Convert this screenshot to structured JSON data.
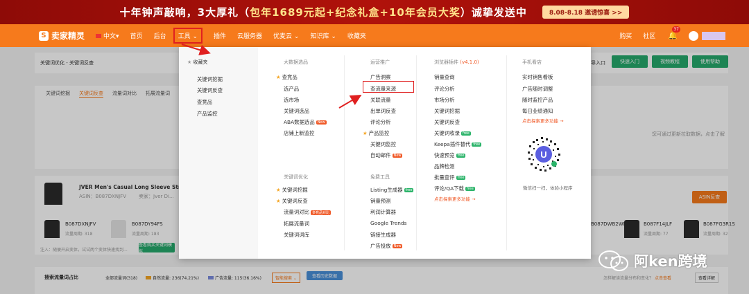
{
  "banner": {
    "text_prefix": "十年钟声敲响，3大厚礼（",
    "text_highlight": "包年1689元起+纪念礼盒+10年会员大奖",
    "text_suffix": "）诚挚发送中",
    "cta": "8.08-8.18 邀请惊喜 >>"
  },
  "topnav": {
    "logo": "卖家精灵",
    "items": [
      "中文",
      "首页",
      "后台",
      "工具",
      "插件",
      "云服务器",
      "优麦云",
      "知识库",
      "收藏夹"
    ],
    "tools_label": "工具",
    "right_items": [
      "购买",
      "社区"
    ],
    "bell_count": "37"
  },
  "background": {
    "breadcrumb": "关键词优化 - 关键词反查",
    "tabs": [
      "关键词挖掘",
      "关键词反查",
      "流量词对比",
      "拓展流量词"
    ],
    "quick_entry": "快速入门",
    "help_tutorial": "视频教程",
    "usage_help": "使用帮助",
    "import_label": "导入口",
    "notice": "您可通过更新拉取数据，点击了解",
    "product_title": "JVER Men's Casual Long Sleeve Stretch Dr...",
    "asin_line": "ASIN：B087DXNJFV",
    "seller": "卖家：Jver Di...",
    "asin_btn": "ASIN反查",
    "variants": [
      "B087DXNJFV",
      "B087DY94FS",
      "B087DWB2WP",
      "B087F14JLF",
      "B087FG3R1S"
    ],
    "variant_sub": [
      "流量周期: 318",
      "流量周期: 183",
      "",
      "流量周期: 77",
      "流量周期: 32"
    ],
    "hint": "注入：随便开启变体，试试两个变体快速找到...",
    "batch_btn": "查看购买关键词模拟",
    "share_title": "搜索流量词占比",
    "share_total": "全部流量词(318)",
    "share_natural": "自然流量: 236(74.21%)",
    "share_ad": "广告流量: 115(36.16%)",
    "share_select": "智能搜索",
    "share_export": "查看历史数据",
    "share_right": "怎样解读流量分布和变化？",
    "share_link": "点击查看",
    "share_right2": "查看详解"
  },
  "dropdown": {
    "fav": {
      "title": "收藏夹",
      "items": [
        "关键词挖掘",
        "关键词反查",
        "查竞品",
        "产品监控"
      ]
    },
    "data_select": {
      "title": "大数据选品",
      "items": [
        {
          "label": "查竞品",
          "star": true,
          "tag": ""
        },
        {
          "label": "选产品",
          "star": false,
          "tag": ""
        },
        {
          "label": "选市场",
          "star": false,
          "tag": ""
        },
        {
          "label": "关键词选品",
          "star": false,
          "tag": ""
        },
        {
          "label": "ABA数据选品",
          "star": false,
          "tag": "New"
        },
        {
          "label": "店铺上新监控",
          "star": false,
          "tag": ""
        }
      ]
    },
    "keyword_opt": {
      "title": "关键词优化",
      "items": [
        {
          "label": "关键词挖掘",
          "star": true,
          "tag": ""
        },
        {
          "label": "关键词反查",
          "star": true,
          "tag": ""
        },
        {
          "label": "流量词对比",
          "star": false,
          "tag": "多竞品对比"
        },
        {
          "label": "拓展流量词",
          "star": false,
          "tag": ""
        },
        {
          "label": "关键词词库",
          "star": false,
          "tag": ""
        }
      ]
    },
    "ads": {
      "title": "运营推广",
      "items": [
        {
          "label": "广告洞察",
          "star": false,
          "tag": ""
        },
        {
          "label": "查流量来源",
          "star": false,
          "tag": ""
        },
        {
          "label": "关联流量",
          "star": false,
          "tag": ""
        },
        {
          "label": "出单词反查",
          "star": false,
          "tag": ""
        },
        {
          "label": "评论分析",
          "star": false,
          "tag": ""
        },
        {
          "label": "产品监控",
          "star": true,
          "tag": ""
        },
        {
          "label": "关键词监控",
          "star": false,
          "tag": ""
        },
        {
          "label": "自动邮件",
          "star": false,
          "tag": "New"
        }
      ]
    },
    "free": {
      "title": "免费工具",
      "items": [
        {
          "label": "Listing生成器",
          "tag": "free"
        },
        {
          "label": "销量预测",
          "tag": ""
        },
        {
          "label": "利润计算器",
          "tag": ""
        },
        {
          "label": "Google Trends",
          "tag": ""
        },
        {
          "label": "链接生成器",
          "tag": ""
        },
        {
          "label": "广告投放",
          "tag": "New"
        }
      ]
    },
    "plugin": {
      "title": "浏览器插件",
      "version": "(v4.1.0)",
      "items": [
        {
          "label": "销量查询",
          "tag": ""
        },
        {
          "label": "评论分析",
          "tag": ""
        },
        {
          "label": "市场分析",
          "tag": ""
        },
        {
          "label": "关键词挖掘",
          "tag": ""
        },
        {
          "label": "关键词反查",
          "tag": ""
        },
        {
          "label": "关键词收录",
          "tag": "free"
        },
        {
          "label": "Keepa插件替代",
          "tag": "free"
        },
        {
          "label": "快速预览",
          "tag": "free"
        },
        {
          "label": "品牌检测",
          "tag": ""
        },
        {
          "label": "批量查评",
          "tag": "free"
        },
        {
          "label": "评论/QA下载",
          "tag": "free"
        }
      ],
      "more": "点击探索更多功能 →"
    },
    "mobile": {
      "title": "手机看店",
      "items": [
        "实时销售看板",
        "广告随时调整",
        "随时监控产品",
        "每日业绩通知"
      ],
      "more": "点击探索更多功能 →",
      "qr_note": "微信扫一扫，体验小程序"
    }
  },
  "watermark": "阿ken跨境",
  "colors": {
    "banner": "#a80f09",
    "nav": "#f67a1c",
    "accent": "#f05a28",
    "annotation": "#e02020",
    "green": "#26a96c"
  }
}
